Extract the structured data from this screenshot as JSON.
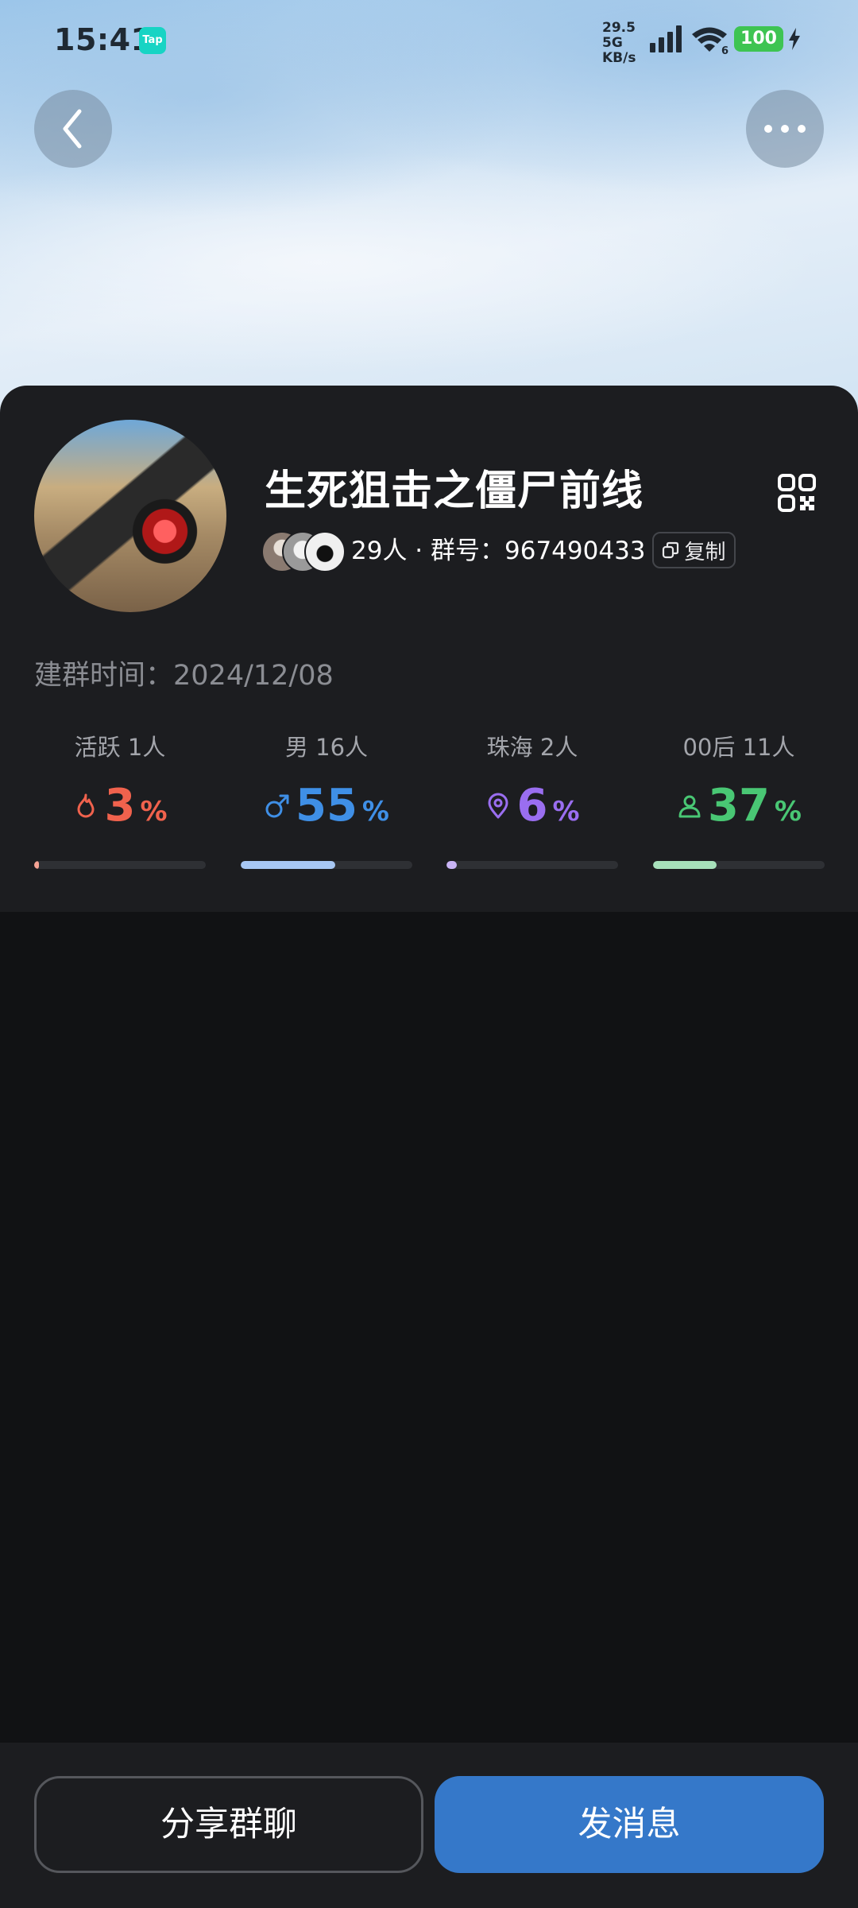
{
  "status_bar": {
    "time": "15:41",
    "app_badge": "Tap",
    "net_speed_value": "29.5",
    "net_speed_unit": "KB/s",
    "network_type": "5G",
    "wifi_badge": "6",
    "battery": "100"
  },
  "nav": {
    "back_icon": "chevron-left-icon",
    "more_icon": "more-dots-icon"
  },
  "group": {
    "name": "生死狙击之僵尸前线",
    "member_count": "29人",
    "separator": " · ",
    "id_label": "群号：",
    "id_value": "967490433",
    "copy_label": "复制",
    "founded_label": "建群时间：",
    "founded_date": "2024/12/08"
  },
  "stats": [
    {
      "label": "活跃 1人",
      "value": "3",
      "unit": "%",
      "icon": "flame-icon",
      "color": "#f0624d",
      "bar_color": "#f4a394",
      "fill_percent": 3
    },
    {
      "label": "男 16人",
      "value": "55",
      "unit": "%",
      "icon": "male-icon",
      "color": "#3f8fe6",
      "bar_color": "#a7c7f3",
      "fill_percent": 55
    },
    {
      "label": "珠海 2人",
      "value": "6",
      "unit": "%",
      "icon": "location-pin-icon",
      "color": "#9a6ef0",
      "bar_color": "#c9b4f5",
      "fill_percent": 6
    },
    {
      "label": "00后 11人",
      "value": "37",
      "unit": "%",
      "icon": "person-icon",
      "color": "#49c774",
      "bar_color": "#a7e1bb",
      "fill_percent": 37
    }
  ],
  "actions": {
    "share_label": "分享群聊",
    "send_label": "发消息"
  },
  "colors": {
    "background": "#111214",
    "card": "#1c1d20",
    "primary_button": "#3578c9"
  }
}
